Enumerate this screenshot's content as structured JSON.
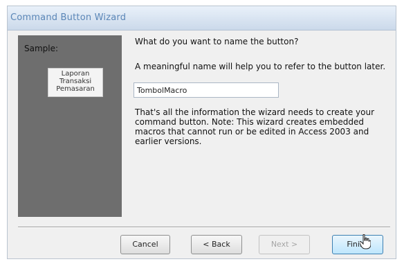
{
  "window": {
    "title": "Command Button Wizard"
  },
  "sample": {
    "label": "Sample:",
    "button_lines": [
      "Laporan",
      "Transaksi",
      "Pemasaran"
    ]
  },
  "main": {
    "question": "What do you want to name the button?",
    "help": "A meaningful name will help you to refer to the button later.",
    "name_value": "TombolMacro",
    "info": "That's all the information the wizard needs to create your command button. Note: This wizard creates embedded macros that cannot run or be edited in Access 2003 and earlier versions."
  },
  "buttons": {
    "cancel": "Cancel",
    "back": "< Back",
    "next": "Next >",
    "finish": "Finish"
  },
  "icons": {
    "cursor": "hand-pointer-icon"
  }
}
